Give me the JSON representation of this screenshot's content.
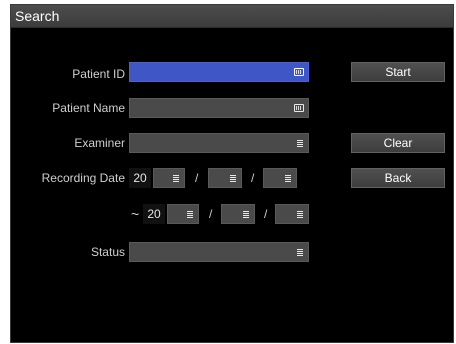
{
  "window": {
    "title": "Search"
  },
  "form": {
    "patient_id": {
      "label": "Patient ID",
      "value": ""
    },
    "patient_name": {
      "label": "Patient Name",
      "value": ""
    },
    "examiner": {
      "label": "Examiner",
      "value": ""
    },
    "recording_date": {
      "label": "Recording Date",
      "from": {
        "year_prefix": "20",
        "year": "",
        "month": "",
        "day": ""
      },
      "range_separator": "~",
      "to": {
        "year_prefix": "20",
        "year": "",
        "month": "",
        "day": ""
      },
      "date_separator": "/"
    },
    "status": {
      "label": "Status",
      "value": ""
    }
  },
  "buttons": {
    "start": "Start",
    "clear": "Clear",
    "back": "Back"
  },
  "icons": {
    "keyboard": "keyboard-icon",
    "list": "list-icon"
  },
  "colors": {
    "active_field": "#3f56c6",
    "field": "#4a4a4a",
    "background": "#000000"
  }
}
